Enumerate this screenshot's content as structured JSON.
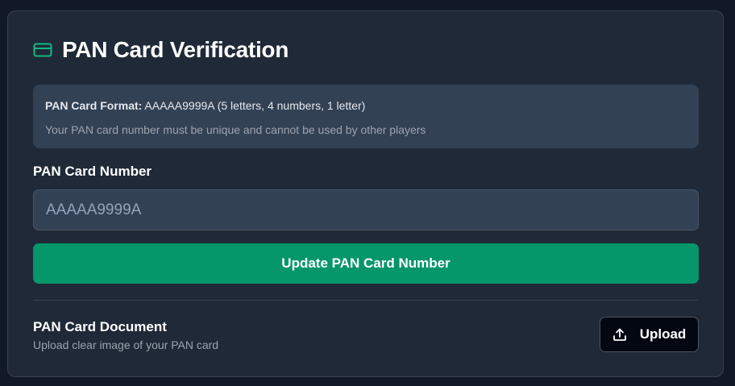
{
  "header": {
    "icon": "credit-card-icon",
    "title": "PAN Card Verification",
    "accent_color": "#10b981"
  },
  "info": {
    "format_label": "PAN Card Format:",
    "format_value": " AAAAA9999A (5 letters, 4 numbers, 1 letter)",
    "note": "Your PAN card number must be unique and cannot be used by other players"
  },
  "pan_field": {
    "label": "PAN Card Number",
    "placeholder": "AAAAA9999A",
    "value": ""
  },
  "update_button": {
    "label": "Update PAN Card Number",
    "color": "#059669"
  },
  "document": {
    "title": "PAN Card Document",
    "subtitle": "Upload clear image of your PAN card",
    "upload_icon": "upload-icon",
    "upload_label": "Upload"
  }
}
